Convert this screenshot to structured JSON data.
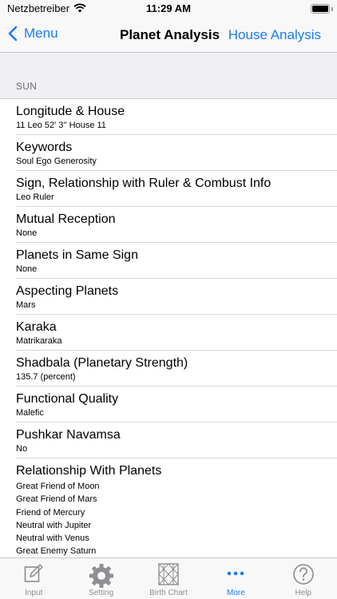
{
  "status": {
    "carrier": "Netzbetreiber",
    "time": "11:29 AM"
  },
  "navbar": {
    "back_label": "Menu",
    "title": "Planet Analysis",
    "right_label": "House Analysis"
  },
  "section": {
    "header": "SUN"
  },
  "rows": [
    {
      "title": "Longitude & House",
      "subtitle": "11 Leo 52' 3'' House 11"
    },
    {
      "title": "Keywords",
      "subtitle": "Soul Ego Generosity"
    },
    {
      "title": "Sign, Relationship with Ruler & Combust Info",
      "subtitle": "Leo Ruler"
    },
    {
      "title": "Mutual Reception",
      "subtitle": "None"
    },
    {
      "title": "Planets in Same Sign",
      "subtitle": "None"
    },
    {
      "title": "Aspecting Planets",
      "subtitle": "Mars"
    },
    {
      "title": "Karaka",
      "subtitle": "Matrikaraka"
    },
    {
      "title": "Shadbala (Planetary Strength)",
      "subtitle": "135.7 (percent)"
    },
    {
      "title": "Functional Quality",
      "subtitle": "Malefic"
    },
    {
      "title": "Pushkar Navamsa",
      "subtitle": "No"
    }
  ],
  "relationships": {
    "title": "Relationship With Planets",
    "lines": [
      "Great Friend of Moon",
      "Great Friend of Mars",
      "Friend of Mercury",
      "Neutral with Jupiter",
      "Neutral with Venus",
      "Great Enemy Saturn"
    ]
  },
  "tabbar": {
    "tabs": [
      {
        "label": "Input",
        "icon": "edit-icon"
      },
      {
        "label": "Setting",
        "icon": "gear-icon"
      },
      {
        "label": "Birth Chart",
        "icon": "chart-grid-icon"
      },
      {
        "label": "More",
        "icon": "more-dots-icon"
      },
      {
        "label": "Help",
        "icon": "help-icon"
      }
    ],
    "active_index": 3
  },
  "colors": {
    "accent": "#1a7cf5",
    "inactive": "#8e8e93",
    "background": "#efeff4"
  }
}
